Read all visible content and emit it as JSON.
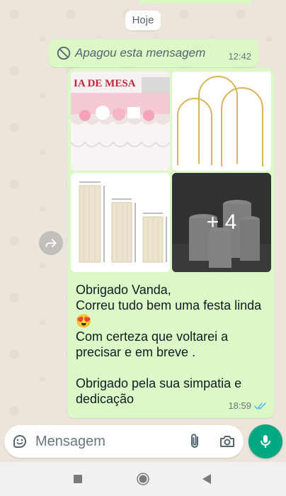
{
  "chat": {
    "date_chip": "Hoje",
    "deleted_message": {
      "text": "Apagou esta mensagem",
      "time": "12:42",
      "icon": "block-icon"
    },
    "media_message": {
      "thumbnails": [
        {
          "name": "table-decoration-photo",
          "caption": "IA DE MESA"
        },
        {
          "name": "gold-arch-stands-photo"
        },
        {
          "name": "cylinder-pedestals-photo"
        },
        {
          "name": "white-cylinders-photo",
          "more_label": "+ 4"
        }
      ],
      "text": "Obrigado Vanda,\nCorreu tudo bem uma festa linda 😍\nCom certeza que voltarei a precisar e em breve .\n\nObrigado pela sua simpatia e dedicação",
      "time": "18:59",
      "status_icon": "double-check-icon",
      "status_color": "#53bdeb"
    }
  },
  "composer": {
    "placeholder": "Mensagem",
    "emoji_icon": "sticker-icon",
    "attach_icon": "paperclip-icon",
    "camera_icon": "camera-icon",
    "mic_icon": "mic-icon",
    "accent": "#00a884"
  },
  "colors": {
    "outgoing_bubble": "#dcf8c6",
    "chat_background": "#ece5db"
  }
}
